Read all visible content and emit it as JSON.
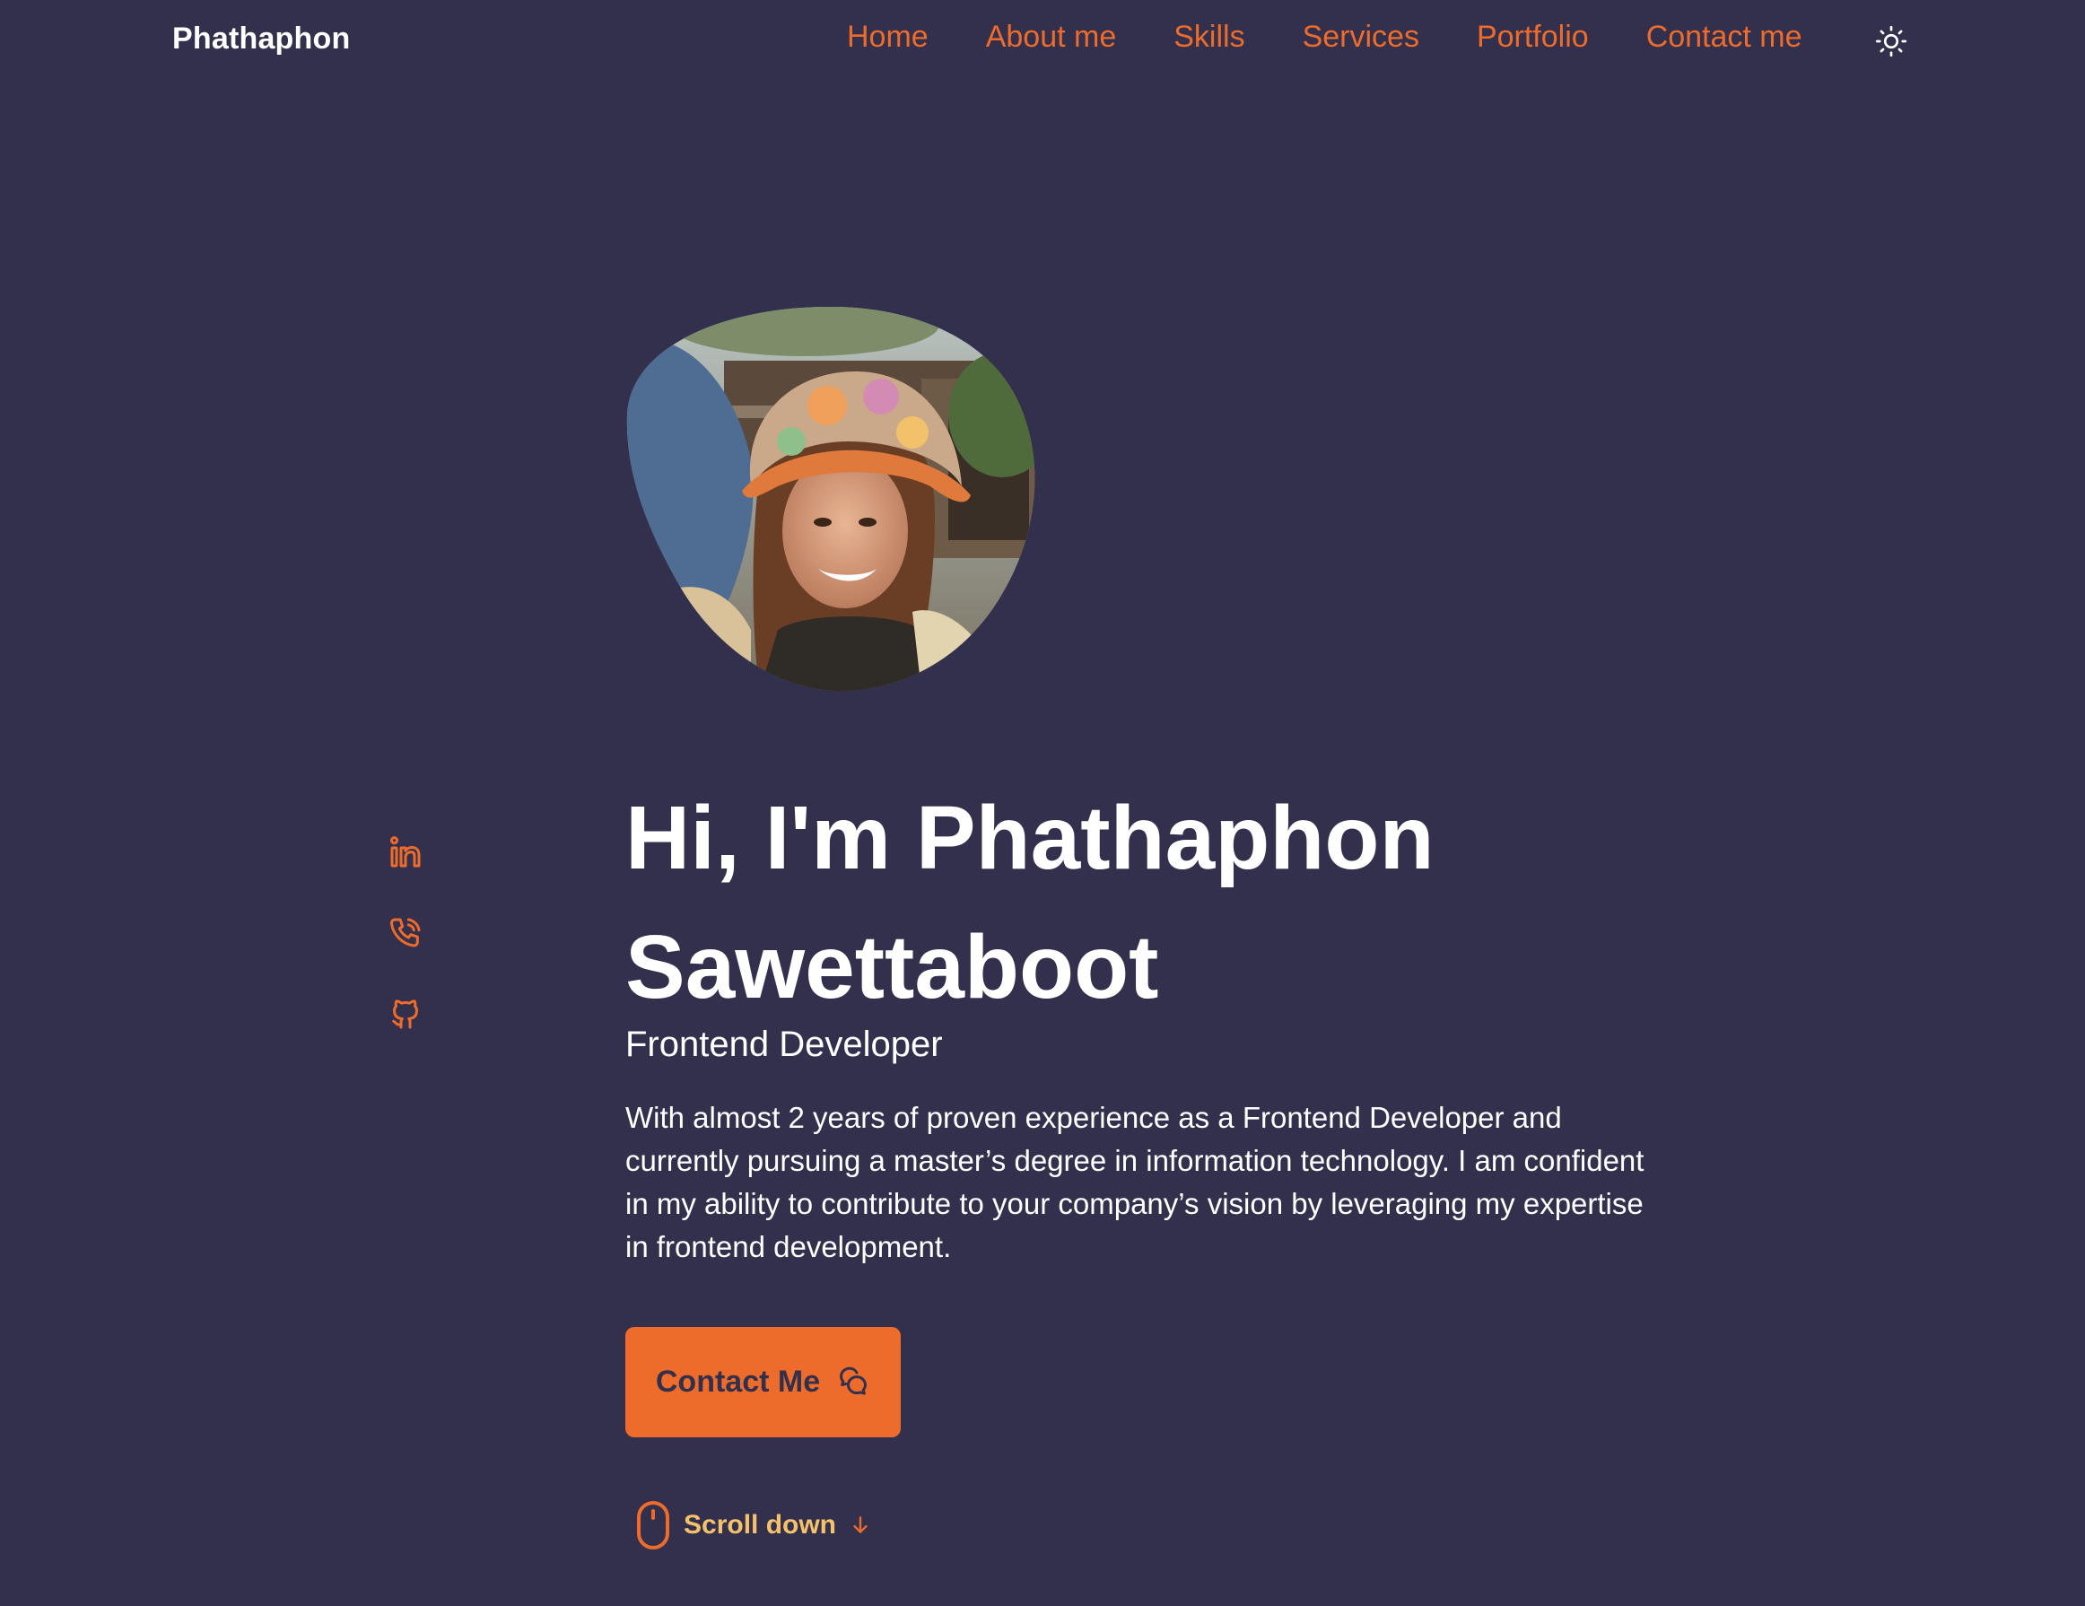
{
  "header": {
    "logo": "Phathaphon",
    "nav": [
      "Home",
      "About me",
      "Skills",
      "Services",
      "Portfolio",
      "Contact me"
    ],
    "theme_icon": "sun-icon"
  },
  "hero": {
    "avatar_icon": "profile-photo",
    "title": "Hi, I'm Phathaphon Sawettaboot",
    "subtitle": "Frontend Developer",
    "description": "With almost 2 years of proven experience as a Frontend Developer and currently pursuing a master’s degree in information technology. I am confident in my ability to contribute to your company’s vision by leveraging my expertise in frontend development.",
    "contact_button": "Contact Me",
    "contact_icon": "chat-icon",
    "scroll_label": "Scroll down"
  },
  "social": [
    "linkedin-icon",
    "phone-icon",
    "github-icon"
  ],
  "colors": {
    "background": "#32304d",
    "accent": "#ee6c2b",
    "scroll_text": "#f5c26b",
    "text": "#ffffff"
  }
}
